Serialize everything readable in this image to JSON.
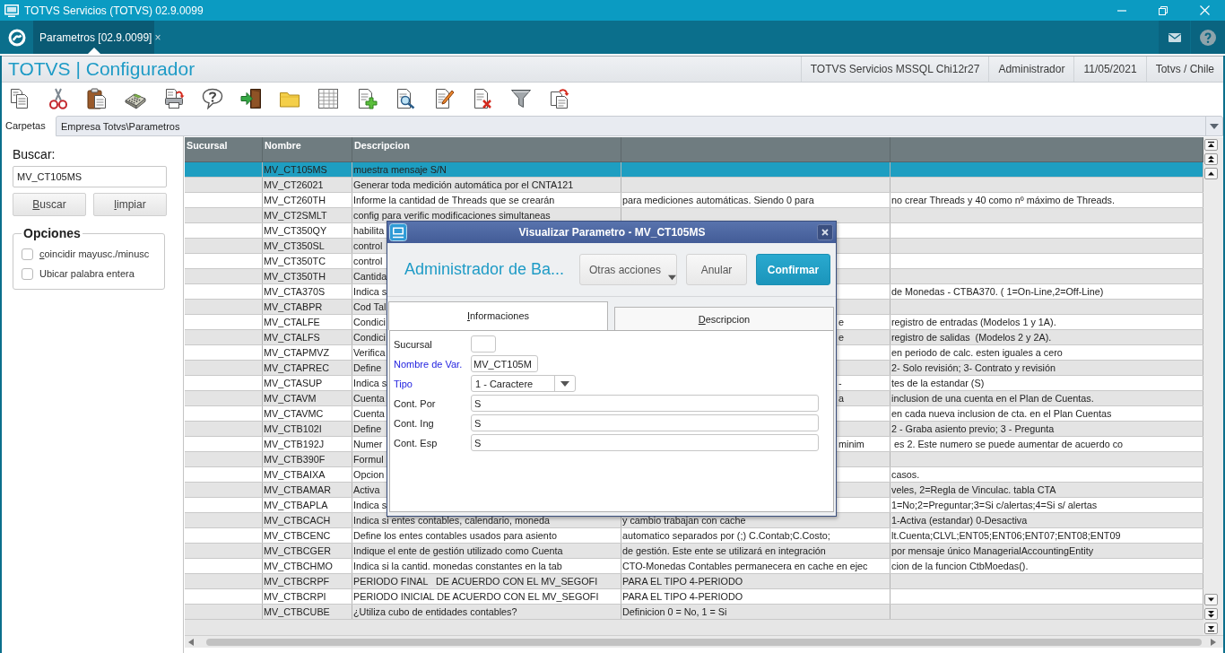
{
  "window": {
    "title": "TOTVS Servicios (TOTVS) 02.9.0099"
  },
  "tabs": [
    {
      "label": "Parametros [02.9.0099]",
      "close": "×",
      "selected": true
    }
  ],
  "header": {
    "title": "TOTVS | Configurador",
    "info": [
      "TOTVS Servicios MSSQL Chi12r27",
      "Administrador",
      "11/05/2021",
      "Totvs / Chile"
    ]
  },
  "folders": {
    "label": "Carpetas",
    "path": "Empresa Totvs\\Parametros"
  },
  "search": {
    "label": "Buscar:",
    "value": "MV_CT105MS",
    "buttons": [
      "Buscar",
      "limpiar"
    ],
    "options_title": "Opciones",
    "options": [
      {
        "label": "coincidir mayusc./minusc",
        "checked": false
      },
      {
        "label": "Ubicar palabra entera",
        "checked": false
      }
    ]
  },
  "table": {
    "columns": [
      "Sucursal",
      "Nombre",
      "Descripcion"
    ],
    "rows": [
      {
        "selected": true,
        "nombre": "MV_CT105MS",
        "descripcion": "muestra mensaje S/N"
      },
      {
        "selected": false,
        "nombre": "MV_CT26021",
        "descripcion": "Generar toda medición automática por el CNTA121"
      },
      {
        "selected": false,
        "nombre": "MV_CT260TH",
        "descripcion": "Informe la cantidad de Threads que se crearán",
        "column_4": "para mediciones automáticas. Siendo 0 para",
        "column_5": "no crear Threads y 40 como nº máximo de Threads."
      },
      {
        "selected": false,
        "nombre": "MV_CT2SMLT",
        "descripcion": "config para verific modificaciones simultaneas"
      },
      {
        "selected": false,
        "nombre": "MV_CT350QY",
        "descripcion": "habilita"
      },
      {
        "selected": false,
        "nombre": "MV_CT350SL",
        "descripcion": "control"
      },
      {
        "selected": false,
        "nombre": "MV_CT350TC",
        "descripcion": "control"
      },
      {
        "selected": false,
        "nombre": "MV_CT350TH",
        "descripcion": "Cantida"
      },
      {
        "selected": false,
        "nombre": "MV_CTA370S",
        "descripcion": "Indica s",
        "column_5": "de Monedas - CTBA370. ( 1=On-Line,2=Off-Line)"
      },
      {
        "selected": false,
        "nombre": "MV_CTABPR",
        "descripcion": "Cod Tal"
      },
      {
        "selected": false,
        "nombre": "MV_CTALFE",
        "descripcion": "Condici",
        "column_4_tail": "e",
        "column_5": "registro de entradas (Modelos 1 y 1A)."
      },
      {
        "selected": false,
        "nombre": "MV_CTALFS",
        "descripcion": "Condici",
        "column_4_tail": "e",
        "column_5": "registro de salidas  (Modelos 2 y 2A)."
      },
      {
        "selected": false,
        "nombre": "MV_CTAPMVZ",
        "descripcion": "Verifica",
        "column_5": "en periodo de calc. esten iguales a cero"
      },
      {
        "selected": false,
        "nombre": "MV_CTAPREC",
        "descripcion": "Define",
        "column_5": "2- Solo revisión; 3- Contrato y revisión"
      },
      {
        "selected": false,
        "nombre": "MV_CTASUP",
        "descripcion": "Indica s",
        "column_4_tail": "-",
        "column_5": "tes de la estandar (S)"
      },
      {
        "selected": false,
        "nombre": "MV_CTAVM",
        "descripcion": "Cuenta",
        "column_4_tail": "a",
        "column_5": "inclusion de una cuenta en el Plan de Cuentas."
      },
      {
        "selected": false,
        "nombre": "MV_CTAVMC",
        "descripcion": "Cuenta",
        "column_5": "en cada nueva inclusion de cta. en el Plan Cuentas"
      },
      {
        "selected": false,
        "nombre": "MV_CTB102I",
        "descripcion": "Define",
        "column_5": "2 - Graba asiento previo; 3 - Pregunta"
      },
      {
        "selected": false,
        "nombre": "MV_CTB192J",
        "descripcion": "Numer",
        "column_4_tail": "minim",
        "column_5": " es 2. Este numero se puede aumentar de acuerdo co"
      },
      {
        "selected": false,
        "nombre": "MV_CTB390F",
        "descripcion": "Formul"
      },
      {
        "selected": false,
        "nombre": "MV_CTBAIXA",
        "descripcion": "Opcion",
        "column_5": "casos."
      },
      {
        "selected": false,
        "nombre": "MV_CTBAMAR",
        "descripcion": "Activa",
        "column_5": "veles, 2=Regla de Vinculac. tabla CTA"
      },
      {
        "selected": false,
        "nombre": "MV_CTBAPLA",
        "descripcion": "Indica s",
        "column_5": "1=No;2=Preguntar;3=Si c/alertas;4=Si s/ alertas"
      },
      {
        "selected": false,
        "nombre": "MV_CTBCACH",
        "descripcion": "Indica si entes contables, calendario, moneda",
        "column_4": "y cambio trabajan con cache",
        "column_5": "1-Activa (estandar) 0-Desactiva"
      },
      {
        "selected": false,
        "nombre": "MV_CTBCENC",
        "descripcion": "Define los entes contables usados para asiento",
        "column_4": "automatico separados por (;) C.Contab;C.Costo;",
        "column_5": "lt.Cuenta;CLVL;ENT05;ENT06;ENT07;ENT08;ENT09"
      },
      {
        "selected": false,
        "nombre": "MV_CTBCGER",
        "descripcion": "Indique el ente de gestión utilizado como Cuenta",
        "column_4": "de gestión. Este ente se utilizará en integración",
        "column_5": "por mensaje único ManagerialAccountingEntity"
      },
      {
        "selected": false,
        "nombre": "MV_CTBCHMO",
        "descripcion": "Indica si la cantid. monedas constantes en la tab",
        "column_4": "CTO-Monedas Contables permanecera en cache en ejec",
        "column_5": "cion de la funcion CtbMoedas()."
      },
      {
        "selected": false,
        "nombre": "MV_CTBCRPF",
        "descripcion": "PERIODO FINAL   DE ACUERDO CON EL MV_SEGOFI",
        "column_4": "PARA EL TIPO 4-PERIODO"
      },
      {
        "selected": false,
        "nombre": "MV_CTBCRPI",
        "descripcion": "PERIODO INICIAL DE ACUERDO CON EL MV_SEGOFI",
        "column_4": "PARA EL TIPO 4-PERIODO"
      },
      {
        "selected": false,
        "nombre": "MV_CTBCUBE",
        "descripcion": "¿Utiliza cubo de entidades contables?",
        "column_4": "Definicion 0 = No, 1 = Si"
      }
    ]
  },
  "dialog": {
    "title": "Visualizar Parametro - MV_CT105MS",
    "heading": "Administrador de Ba...",
    "buttons": [
      {
        "label": "Otras acciones",
        "kind": "menu"
      },
      {
        "label": "Anular",
        "kind": "cancel"
      },
      {
        "label": "Confirmar",
        "kind": "confirm"
      }
    ],
    "tabs": [
      {
        "label": "Informaciones",
        "selected": true
      },
      {
        "label": "Descripcion",
        "selected": false
      }
    ],
    "fields": [
      {
        "label": "Sucursal",
        "required": false,
        "kind": "text"
      },
      {
        "label": "Nombre de Var.",
        "required": true,
        "kind": "text",
        "value": "MV_CT105M"
      },
      {
        "label": "Tipo",
        "required": true,
        "kind": "select",
        "value": "1 - Caractere"
      },
      {
        "label": "Cont. Por",
        "required": false,
        "kind": "text",
        "value": "S"
      },
      {
        "label": "Cont. Ing",
        "required": false,
        "kind": "text",
        "value": "S"
      },
      {
        "label": "Cont. Esp",
        "required": false,
        "kind": "text",
        "value": "S"
      }
    ]
  }
}
